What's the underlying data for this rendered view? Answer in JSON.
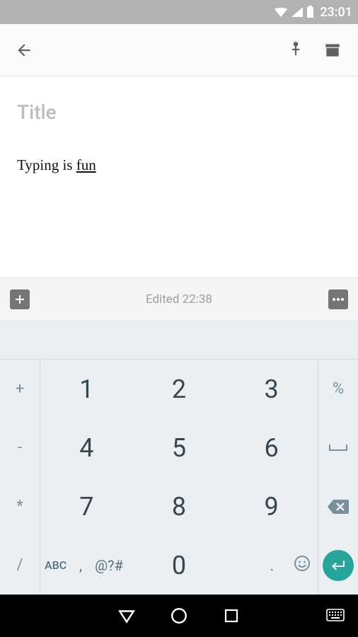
{
  "status": {
    "time": "23:01"
  },
  "editor": {
    "title_placeholder": "Title",
    "body_text_prefix": "Typing is ",
    "body_text_underline": "fun"
  },
  "footer": {
    "edited_label": "Edited 22:38"
  },
  "keyboard": {
    "left_side": [
      "+",
      "-",
      "*",
      "/"
    ],
    "right_side": [
      "%",
      "⎵",
      "⌫",
      "↵"
    ],
    "nums": [
      [
        "1",
        "2",
        "3"
      ],
      [
        "4",
        "5",
        "6"
      ],
      [
        "7",
        "8",
        "9"
      ]
    ],
    "bottom_mode": "ABC",
    "bottom_comma": ",",
    "bottom_sym": "@?#",
    "bottom_zero": "0",
    "bottom_dot": "."
  }
}
